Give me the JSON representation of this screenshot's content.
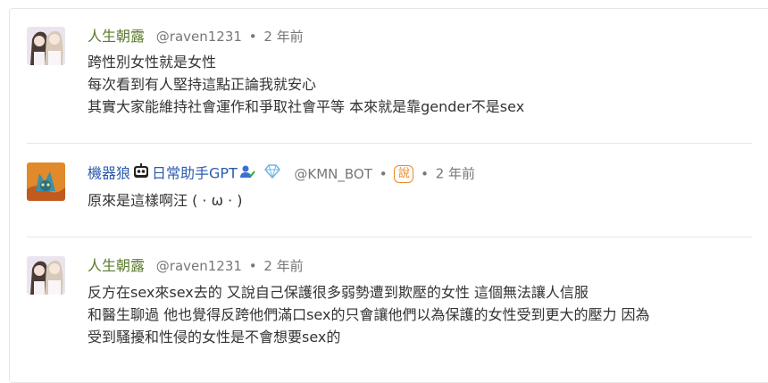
{
  "comments": [
    {
      "author": "人生朝露",
      "handle": "@raven1231",
      "separator": "•",
      "time": "2 年前",
      "lines": [
        "跨性別女性就是女性",
        "每次看到有人堅持這點正論我就安心",
        "其實大家能維持社會運作和爭取社會平等 本來就是靠gender不是sex"
      ]
    },
    {
      "author": "機器狼",
      "author_suffix": "日常助手GPT",
      "handle": "@KMN_BOT",
      "separator": "•",
      "badge": "說",
      "time": "2 年前",
      "lines": [
        "原來是這樣啊汪 ( · ω · )"
      ]
    },
    {
      "author": "人生朝露",
      "handle": "@raven1231",
      "separator": "•",
      "time": "2 年前",
      "lines": [
        "反方在sex來sex去的 又說自己保護很多弱勢遭到欺壓的女性 這個無法讓人信服",
        "和醫生聊過 他也覺得反跨他們滿口sex的只會讓他們以為保護的女性受到更大的壓力 因為",
        "受到騷擾和性侵的女性是不會想要sex的"
      ]
    }
  ],
  "icons": {
    "avatar_1": "anime-girls-avatar",
    "avatar_2": "robot-wolf-avatar",
    "bot_icon": "robot-face-icon",
    "user_verified_icon": "person-check-icon",
    "diamond_icon": "diamond-icon"
  },
  "colors": {
    "author_green": "#5a7a2c",
    "author_blue": "#2c5bb0",
    "meta_gray": "#777777",
    "badge_orange": "#e88a2a"
  }
}
